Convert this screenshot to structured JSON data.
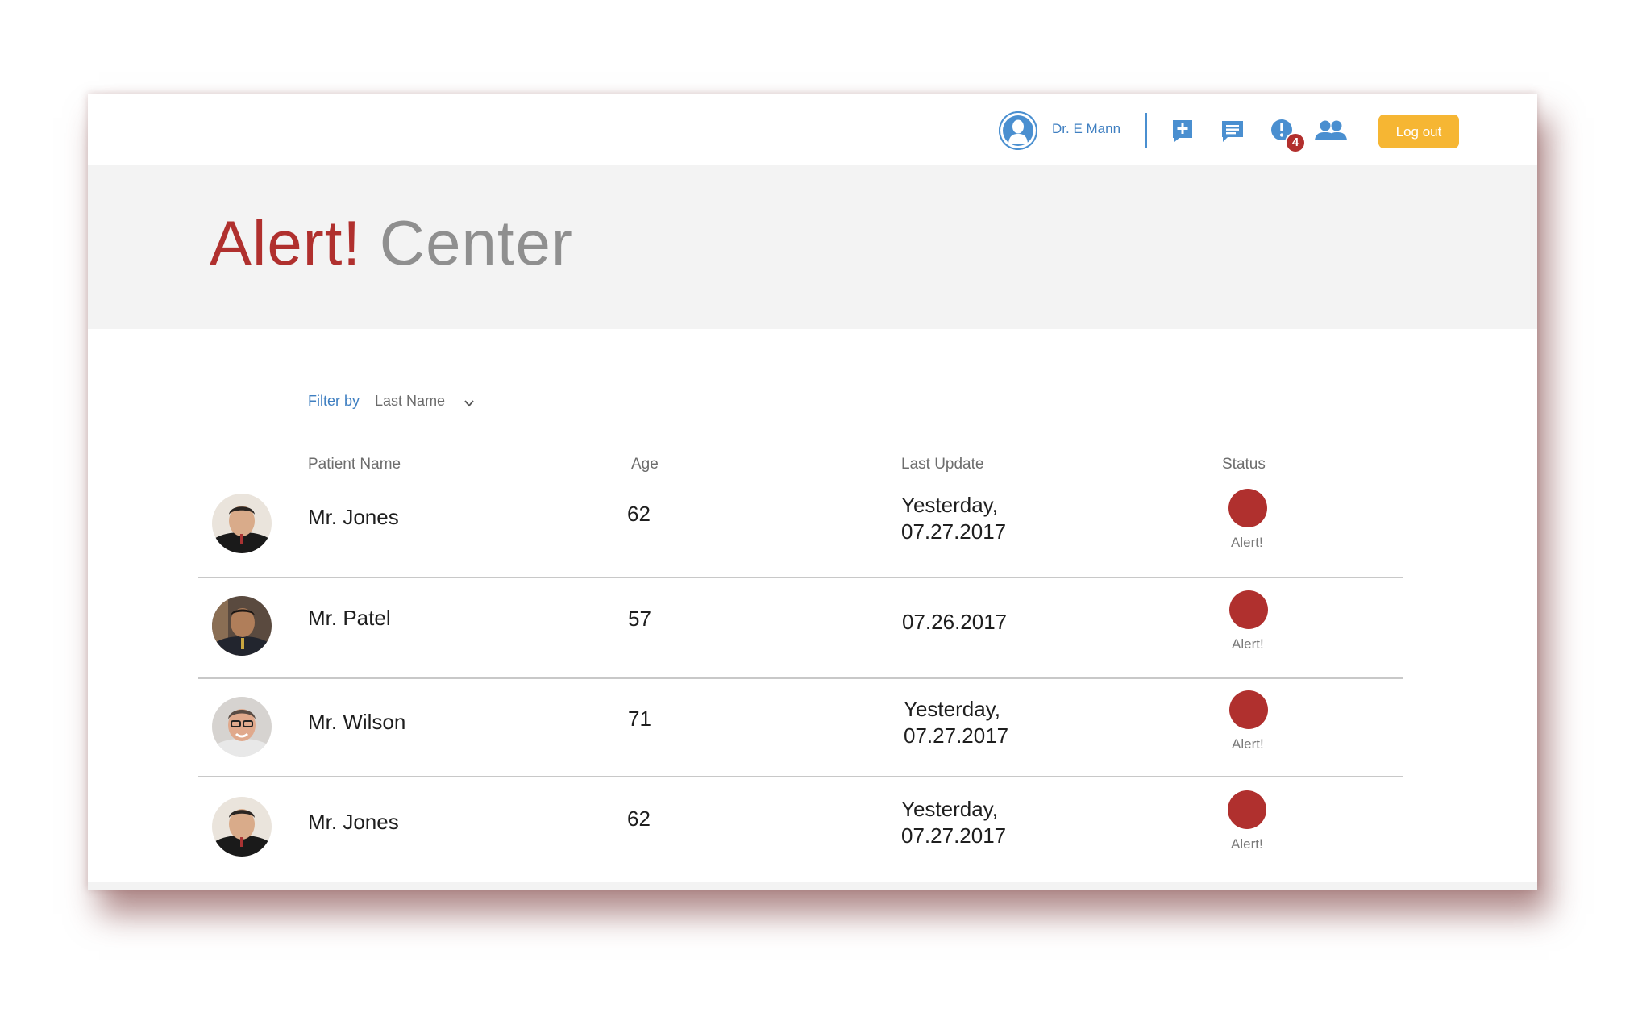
{
  "header": {
    "user_name": "Dr. E Mann",
    "alerts_badge": "4",
    "logout_label": "Log out",
    "icons": [
      "user-avatar-icon",
      "add-note-icon",
      "chat-icon",
      "alert-icon",
      "group-icon"
    ],
    "accent_color": "#4a8fd0",
    "logout_color": "#f6b633"
  },
  "hero": {
    "title_part1": "Alert!",
    "title_part2": "Center",
    "title_color_1": "#b0302e",
    "title_color_2": "#8f8f8f"
  },
  "filter": {
    "label": "Filter by",
    "value": "Last Name"
  },
  "table": {
    "columns": [
      "Patient Name",
      "Age",
      "Last Update",
      "Status"
    ],
    "rows": [
      {
        "name": "Mr. Jones",
        "age": "62",
        "update_line1": "Yesterday,",
        "update_line2": "07.27.2017",
        "status": "Alert!"
      },
      {
        "name": "Mr. Patel",
        "age": "57",
        "update_line1": "07.26.2017",
        "update_line2": "",
        "status": "Alert!"
      },
      {
        "name": "Mr. Wilson",
        "age": "71",
        "update_line1": "Yesterday,",
        "update_line2": "07.27.2017",
        "status": "Alert!"
      },
      {
        "name": "Mr. Jones",
        "age": "62",
        "update_line1": "Yesterday,",
        "update_line2": "07.27.2017",
        "status": "Alert!"
      }
    ],
    "status_color": "#b0302e"
  }
}
